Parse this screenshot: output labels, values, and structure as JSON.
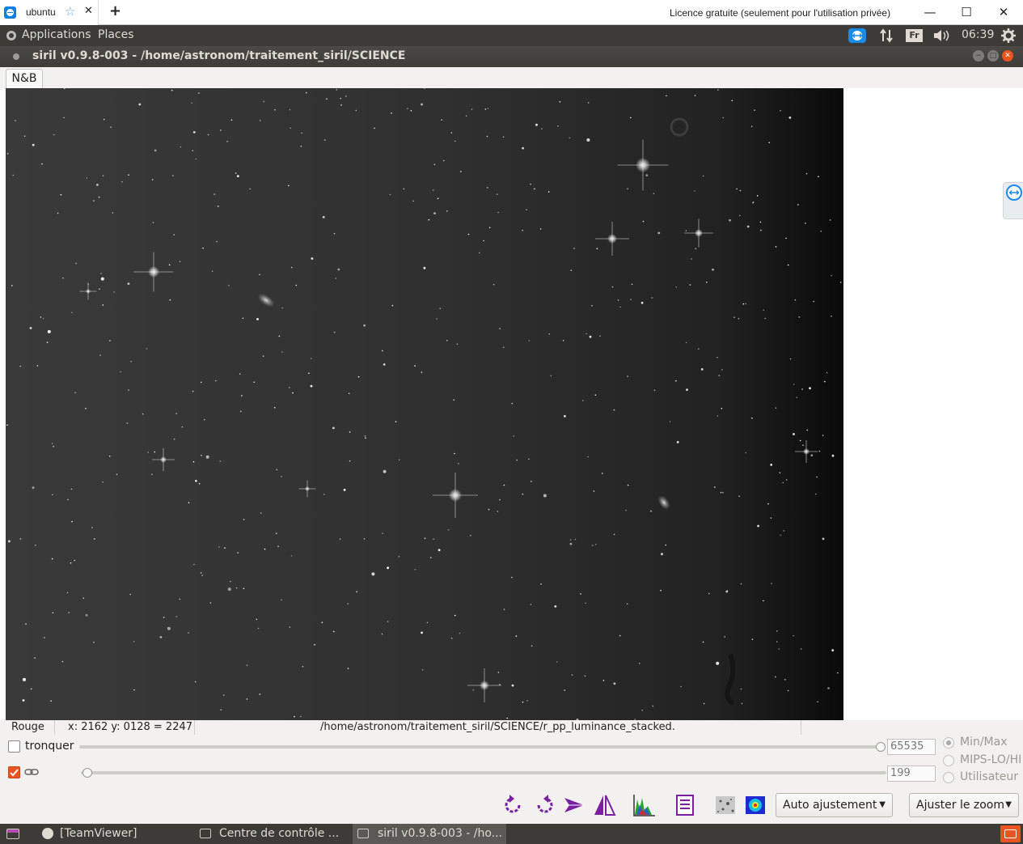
{
  "teamviewer": {
    "tab_label": "ubuntu",
    "license_text": "Licence gratuite (seulement pour l'utilisation privée)",
    "add_tab": "+",
    "star_glyph": "☆",
    "close_glyph": "✕",
    "minimize_glyph": "—",
    "maximize_glyph": "☐",
    "window_close_glyph": "✕"
  },
  "gnome_panel": {
    "menu_applications": "Applications",
    "menu_places": "Places",
    "keyboard_layout": "Fr",
    "time": "06:39"
  },
  "window": {
    "title": "siril v0.9.8-003 - /home/astronom/traitement_siril/SCIENCE"
  },
  "toolbar": {
    "channel_tab": "N&B"
  },
  "statusbar": {
    "channel": "Rouge",
    "coordinates": "x: 2162 y: 0128 = 2247",
    "filename": "/home/astronom/traitement_siril/SCIENCE/r_pp_luminance_stacked."
  },
  "controls": {
    "crop_label": "tronquer",
    "crop_checked": false,
    "link_checked": true,
    "high_value": "65535",
    "low_value": "199",
    "high_slider_fraction": 1.0,
    "low_slider_fraction": 0.0,
    "radio_options": [
      "Min/Max",
      "MIPS-LO/HI",
      "Utilisateur"
    ],
    "selected_radio": "Min/Max",
    "auto_adjust_label": "Auto ajustement",
    "zoom_label": "Ajuster le zoom"
  },
  "taskbar": {
    "items": [
      "[TeamViewer]",
      "Centre de contrôle ...",
      "siril v0.9.8-003 - /ho..."
    ]
  },
  "colors": {
    "panel_dark": "#3c3b37",
    "teamviewer_blue": "#0e7fe1",
    "siril_purple": "#7a1fa2",
    "close_orange": "#e95420"
  }
}
